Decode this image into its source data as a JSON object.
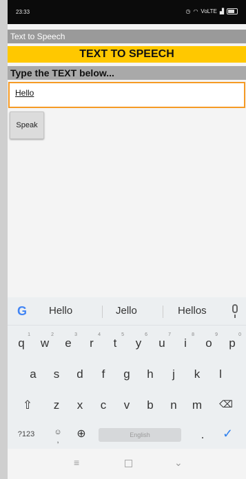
{
  "status_bar": {
    "time": "23:33",
    "network": "VoLTE"
  },
  "app_bar": {
    "title": "Text to Speech"
  },
  "banner": {
    "title": "TEXT TO SPEECH"
  },
  "prompt": {
    "label": "Type the TEXT below..."
  },
  "input": {
    "value": "Hello"
  },
  "speak_button": {
    "label": "Speak"
  },
  "keyboard": {
    "suggestions": [
      "Hello",
      "Jello",
      "Hellos"
    ],
    "row1": [
      "q",
      "w",
      "e",
      "r",
      "t",
      "y",
      "u",
      "i",
      "o",
      "p"
    ],
    "row1_numbers": [
      "1",
      "2",
      "3",
      "4",
      "5",
      "6",
      "7",
      "8",
      "9",
      "0"
    ],
    "row2": [
      "a",
      "s",
      "d",
      "f",
      "g",
      "h",
      "j",
      "k",
      "l"
    ],
    "row3": [
      "z",
      "x",
      "c",
      "v",
      "b",
      "n",
      "m"
    ],
    "symbols_key": "?123",
    "comma_key": ",",
    "space_label": "English",
    "period_key": "."
  },
  "colors": {
    "banner": "#ffc800",
    "input_border": "#f59a24",
    "app_bar": "#9a9a9a",
    "accent": "#2f80ed"
  }
}
